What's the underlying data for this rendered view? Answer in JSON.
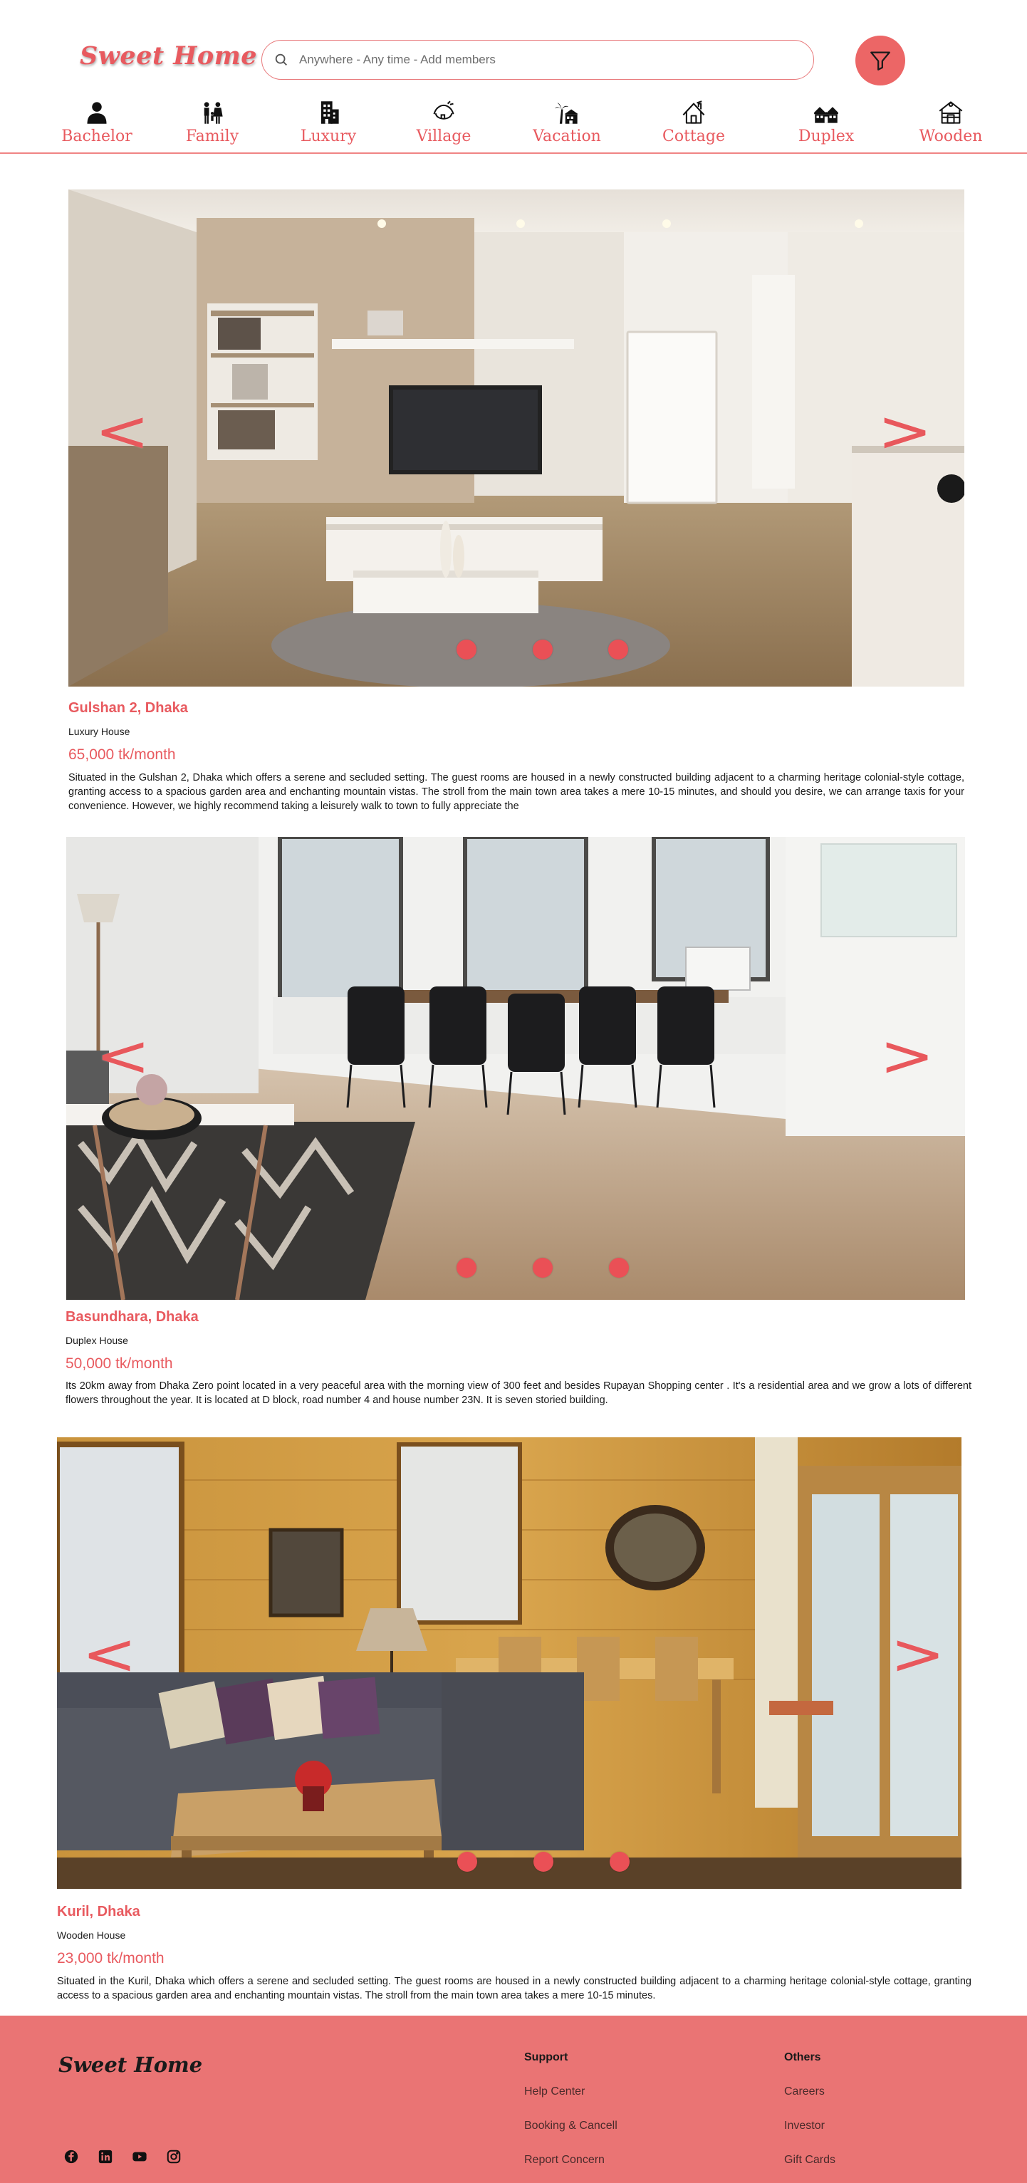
{
  "header": {
    "logo": "Sweet Home",
    "search_placeholder": "Anywhere - Any time - Add members"
  },
  "categories": [
    {
      "label": "Bachelor",
      "icon": "person-icon"
    },
    {
      "label": "Family",
      "icon": "family-icon"
    },
    {
      "label": "Luxury",
      "icon": "building-icon"
    },
    {
      "label": "Village",
      "icon": "hut-icon"
    },
    {
      "label": "Vacation",
      "icon": "palm-tree-icon"
    },
    {
      "label": "Cottage",
      "icon": "cottage-icon"
    },
    {
      "label": "Duplex",
      "icon": "duplex-icon"
    },
    {
      "label": "Wooden",
      "icon": "wooden-house-icon"
    }
  ],
  "listings": [
    {
      "location": "Gulshan 2, Dhaka",
      "type": "Luxury House",
      "price": "65,000 tk/month",
      "description": "Situated in the Gulshan 2, Dhaka which offers a serene and secluded setting. The guest rooms are housed in a newly constructed building adjacent to a charming heritage colonial-style cottage, granting access to a spacious garden area and enchanting mountain vistas. The stroll from the main town area takes a mere 10-15 minutes, and should you desire, we can arrange taxis for your convenience. However, we highly recommend taking a leisurely walk to town to fully appreciate the",
      "prev": "<",
      "next": ">"
    },
    {
      "location": "Basundhara, Dhaka",
      "type": "Duplex House",
      "price": "50,000  tk/month",
      "description": "Its 20km away from Dhaka Zero point located in a very peaceful area with the morning view of 300 feet and besides Rupayan Shopping center . It's a residential area and  we grow a lots of different flowers throughout the year. It is located at D block, road number 4 and house number 23N. It is seven storied building.",
      "prev": "<",
      "next": ">"
    },
    {
      "location": "Kuril, Dhaka",
      "type": "Wooden House",
      "price": "23,000 tk/month",
      "description": "Situated in the Kuril, Dhaka which offers a serene and secluded setting. The guest rooms are housed in a newly constructed building adjacent to a charming heritage colonial-style cottage, granting access to a spacious garden area and enchanting mountain vistas. The stroll from the main town area takes a mere 10-15 minutes.",
      "prev": "<",
      "next": ">"
    }
  ],
  "footer": {
    "logo": "Sweet Home",
    "support": {
      "title": "Support",
      "links": [
        "Help Center",
        "Booking & Cancell",
        "Report  Concern"
      ]
    },
    "others": {
      "title": "Others",
      "links": [
        "Careers",
        "Investor",
        "Gift Cards"
      ]
    },
    "social": [
      "facebook-icon",
      "linkedin-icon",
      "youtube-icon",
      "instagram-icon"
    ]
  },
  "colors": {
    "accent": "#e85a5f",
    "footer_bg": "#ea7474",
    "dot": "#ea5056"
  }
}
